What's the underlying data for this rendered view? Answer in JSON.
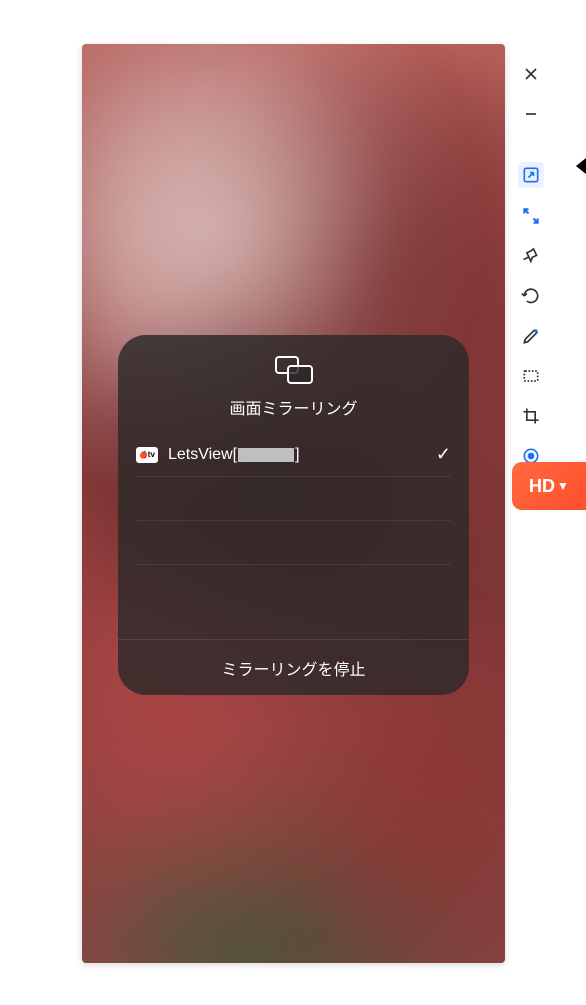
{
  "panel": {
    "title": "画面ミラーリング",
    "device": {
      "prefix": "LetsView[",
      "suffix": "]",
      "badge": "tv"
    },
    "stop_label": "ミラーリングを停止"
  },
  "hd_badge": {
    "label": "HD",
    "arrow": "▼"
  },
  "toolbar": {
    "items": [
      "close",
      "minimize",
      "fit-screen",
      "fullscreen",
      "pin",
      "rotate",
      "edit",
      "rectangle",
      "crop",
      "record"
    ]
  }
}
